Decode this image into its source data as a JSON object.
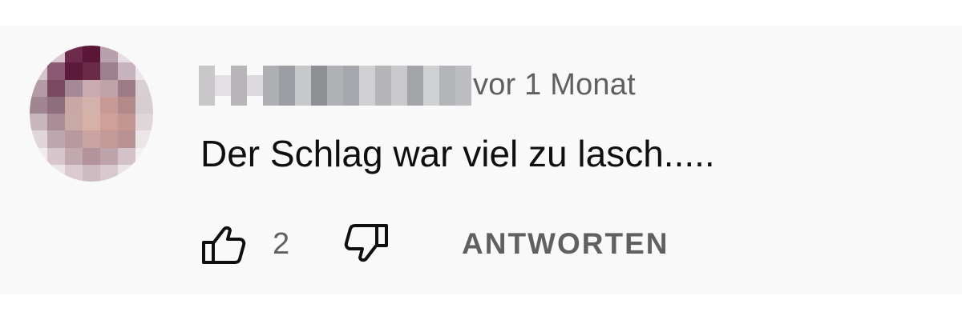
{
  "comment": {
    "timestamp": "vor 1 Monat",
    "text": "Der Schlag war viel zu lasch.....",
    "like_count": "2",
    "reply_label": "ANTWORTEN"
  },
  "icons": {
    "like": "thumbs-up-icon",
    "dislike": "thumbs-down-icon"
  },
  "colors": {
    "background": "#f9f9f9",
    "text_primary": "#0f0f0f",
    "text_secondary": "#606060"
  }
}
